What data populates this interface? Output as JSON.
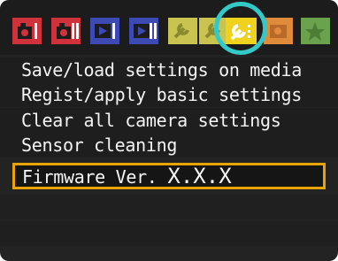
{
  "tabs": [
    {
      "name": "shooting-1",
      "icon": "camera-icon",
      "color": "#d0323c",
      "active": false
    },
    {
      "name": "shooting-2",
      "icon": "camera-icon",
      "color": "#d0323c",
      "active": false
    },
    {
      "name": "playback-1",
      "icon": "playback-icon",
      "color": "#3e4ab3",
      "active": false
    },
    {
      "name": "playback-2",
      "icon": "playback-icon",
      "color": "#3e4ab3",
      "active": false
    },
    {
      "name": "setup-1",
      "icon": "wrench-icon",
      "color": "#c9c450",
      "active": false
    },
    {
      "name": "setup-2",
      "icon": "wrench-icon",
      "color": "#c9c450",
      "active": false
    },
    {
      "name": "setup-3",
      "icon": "wrench-icon",
      "color": "#f0d21c",
      "active": true
    },
    {
      "name": "custom-functions",
      "icon": "custom-function-icon",
      "color": "#e08a3c",
      "active": false
    },
    {
      "name": "my-menu",
      "icon": "star-icon",
      "color": "#6aa24e",
      "active": false
    }
  ],
  "menu": {
    "items": [
      {
        "label": "Save/load settings on media"
      },
      {
        "label": "Regist/apply basic settings"
      },
      {
        "label": "Clear all camera settings"
      },
      {
        "label": "Sensor cleaning"
      },
      {
        "label_prefix": "Firmware Ver.",
        "label_value": "X.X.X",
        "selected": true
      }
    ]
  },
  "colors": {
    "selection_border": "#e8a400",
    "highlight_ring": "#33c9c9",
    "background": "#232323"
  }
}
